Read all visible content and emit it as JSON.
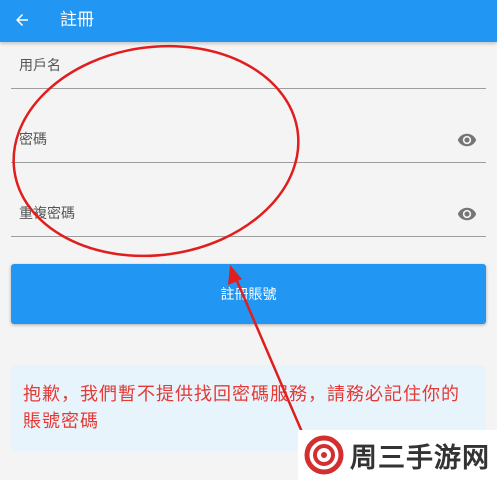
{
  "appbar": {
    "title": "註冊",
    "back_icon": "arrow-back-icon"
  },
  "form": {
    "username": {
      "label": "用戶名",
      "value": ""
    },
    "password": {
      "label": "密碼",
      "value": "",
      "toggle_icon": "eye-icon"
    },
    "confirm_password": {
      "label": "重複密碼",
      "value": "",
      "toggle_icon": "eye-icon"
    },
    "submit_label": "註冊賬號"
  },
  "notice": {
    "text": "抱歉，我們暫不提供找回密碼服務，請務必記住你的賬號密碼"
  },
  "watermark": {
    "text": "周三手游网"
  },
  "colors": {
    "primary": "#2196f3",
    "notice_bg": "#e8f4fc",
    "notice_text": "#e53935",
    "annotation": "#e01e1e"
  }
}
